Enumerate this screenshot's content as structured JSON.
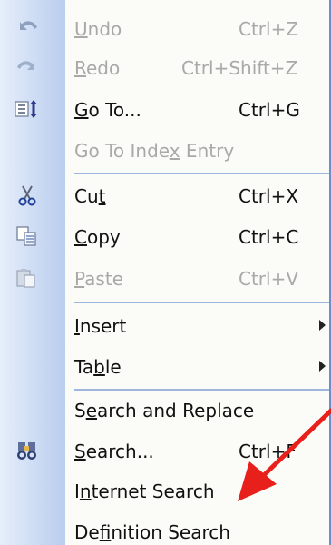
{
  "menu": {
    "items": [
      {
        "pre": "",
        "acc": "U",
        "post": "ndo",
        "shortcut": "Ctrl+Z",
        "icon": "undo-icon",
        "disabled": true
      },
      {
        "pre": "",
        "acc": "R",
        "post": "edo",
        "shortcut": "Ctrl+Shift+Z",
        "icon": "redo-icon",
        "disabled": true
      },
      {
        "pre": "",
        "acc": "G",
        "post": "o To...",
        "shortcut": "Ctrl+G",
        "icon": "goto-icon",
        "disabled": false
      },
      {
        "pre": "Go To Inde",
        "acc": "x",
        "post": " Entry",
        "shortcut": "",
        "icon": "",
        "disabled": true
      },
      {
        "pre": "Cu",
        "acc": "t",
        "post": "",
        "shortcut": "Ctrl+X",
        "icon": "scissors-icon",
        "disabled": false
      },
      {
        "pre": "",
        "acc": "C",
        "post": "opy",
        "shortcut": "Ctrl+C",
        "icon": "copy-icon",
        "disabled": false
      },
      {
        "pre": "",
        "acc": "P",
        "post": "aste",
        "shortcut": "Ctrl+V",
        "icon": "paste-icon",
        "disabled": true
      },
      {
        "pre": "",
        "acc": "I",
        "post": "nsert",
        "shortcut": "",
        "icon": "",
        "disabled": false,
        "submenu": true
      },
      {
        "pre": "Ta",
        "acc": "b",
        "post": "le",
        "shortcut": "",
        "icon": "",
        "disabled": false,
        "submenu": true
      },
      {
        "pre": "S",
        "acc": "e",
        "post": "arch and Replace",
        "shortcut": "",
        "icon": "",
        "disabled": false
      },
      {
        "pre": "",
        "acc": "S",
        "post": "earch...",
        "shortcut": "Ctrl+F",
        "icon": "search-binoculars-icon",
        "disabled": false
      },
      {
        "pre": "I",
        "acc": "n",
        "post": "ternet Search",
        "shortcut": "",
        "icon": "",
        "disabled": false
      },
      {
        "pre": "De",
        "acc": "f",
        "post": "inition Search",
        "shortcut": "",
        "icon": "",
        "disabled": false
      }
    ]
  },
  "annotation": {
    "color": "#e8201c"
  }
}
